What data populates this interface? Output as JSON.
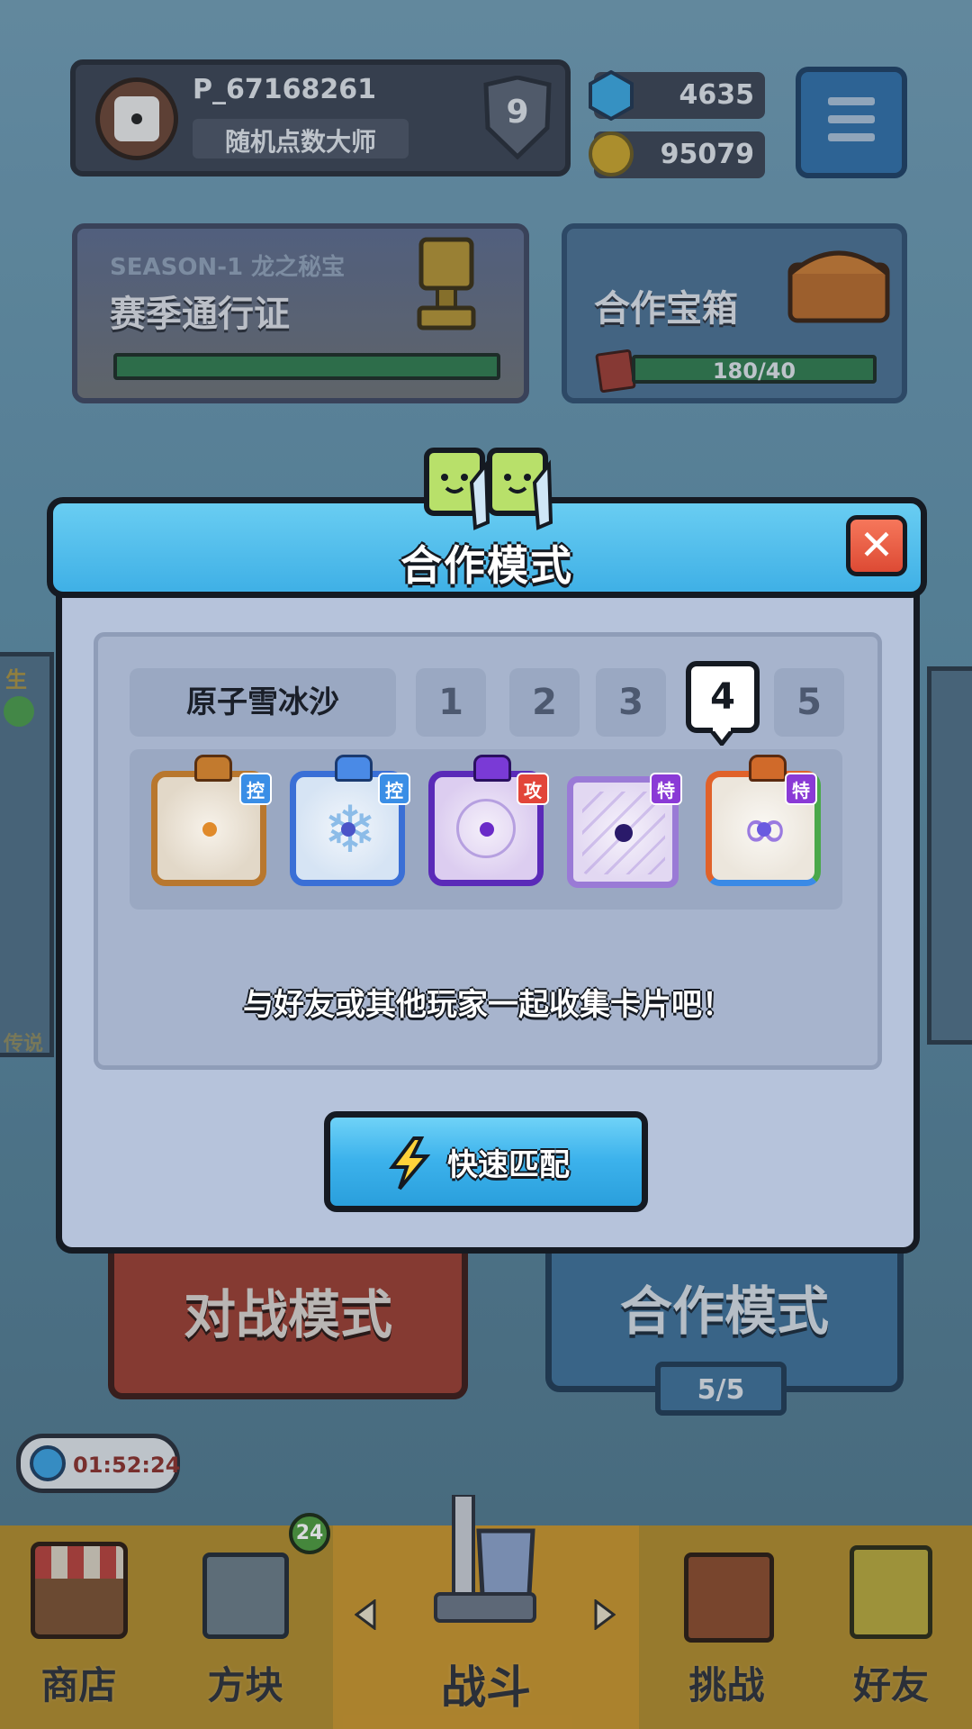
{
  "profile": {
    "username": "P_67168261",
    "title": "随机点数大师",
    "level": "9"
  },
  "currency": {
    "gems": "4635",
    "coins": "95079"
  },
  "season": {
    "label": "SEASON-1 龙之秘宝",
    "title": "赛季通行证"
  },
  "coop_chest": {
    "title": "合作宝箱",
    "progress": "180/40"
  },
  "side_left": {
    "top_text": "生",
    "bottom_text": "传说"
  },
  "modes": {
    "battle": "对战模式",
    "coop": "合作模式",
    "coop_count": "5/5"
  },
  "timer": "01:52:24",
  "nav": {
    "shop": "商店",
    "blocks": "方块",
    "blocks_badge": "24",
    "battle": "战斗",
    "challenge": "挑战",
    "friends": "好友"
  },
  "dialog": {
    "title": "合作模式",
    "close_glyph": "✕",
    "deck_name": "原子雪冰沙",
    "deck_slots": [
      "1",
      "2",
      "3",
      "4",
      "5"
    ],
    "selected_slot": "4",
    "cards": [
      {
        "name": "card-1",
        "tag": "控",
        "tag_color": "#3a8ee6"
      },
      {
        "name": "card-2",
        "tag": "控",
        "tag_color": "#3a8ee6"
      },
      {
        "name": "card-3",
        "tag": "攻",
        "tag_color": "#e2453a"
      },
      {
        "name": "card-4",
        "tag": "特",
        "tag_color": "#8a3ad6"
      },
      {
        "name": "card-5",
        "tag": "特",
        "tag_color": "#8a3ad6"
      }
    ],
    "description": "与好友或其他玩家一起收集卡片吧！",
    "quick_match": "快速匹配"
  },
  "colors": {
    "accent": "#3fb0e6",
    "close": "#e5533d",
    "gold": "#f4b331",
    "gem": "#3aa7e0"
  }
}
